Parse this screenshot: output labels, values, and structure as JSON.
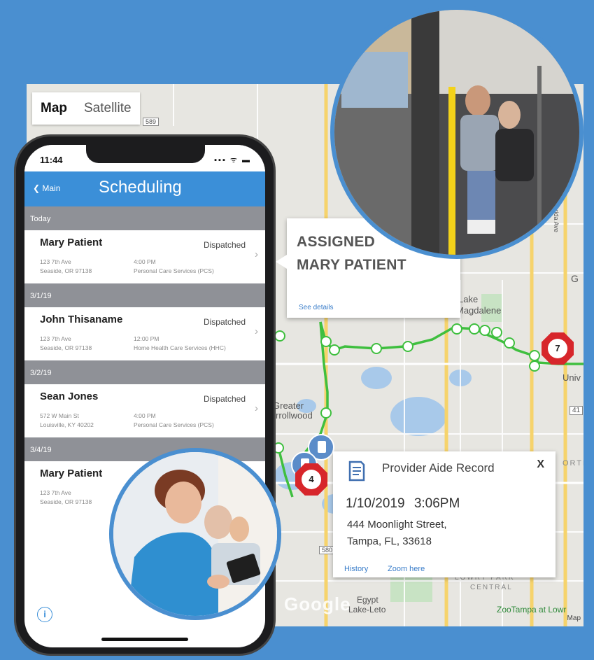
{
  "map": {
    "tabs": {
      "map": "Map",
      "satellite": "Satellite"
    },
    "labels": {
      "lake_magdalene_1": "Lake",
      "lake_magdalene_2": "Magdalene",
      "greater": "Greater",
      "carrollwood": "rrollwood",
      "n_florida_ave": "N Florida Ave",
      "lowry_park": "LOWRY PARK",
      "central": "CENTRAL",
      "egypt": "Egypt",
      "lake_leto": "Lake-Leto",
      "zootampa": "ZooTampa at Lowr",
      "g": "G",
      "univ": "Univ",
      "rte_41": "41",
      "rte_589": "589",
      "rte_580": "580",
      "orte": "ORTE"
    },
    "google": "Google",
    "footer": "Map",
    "markers": {
      "seven": "7",
      "four": "4"
    }
  },
  "assigned_popup": {
    "line1": "ASSIGNED",
    "line2": "MARY PATIENT",
    "link": "See details"
  },
  "aide_popup": {
    "title": "Provider Aide Record",
    "close": "X",
    "date": "1/10/2019",
    "time": "3:06PM",
    "address_line1": "444 Moonlight Street,",
    "address_line2": "Tampa, FL, 33618",
    "history": "History",
    "zoom": "Zoom here"
  },
  "phone": {
    "time": "11:44",
    "signal": "▪▪▪ ᯤ ▬",
    "back": "❮ Main",
    "title": "Scheduling",
    "sections": [
      {
        "day": "Today",
        "name": "Mary Patient",
        "status": "Dispatched",
        "addr1": "123 7th Ave",
        "addr2": "Seaside, OR 97138",
        "time": "4:00 PM",
        "service": "Personal Care Services (PCS)"
      },
      {
        "day": "3/1/19",
        "name": "John Thisaname",
        "status": "Dispatched",
        "addr1": "123 7th Ave",
        "addr2": "Seaside, OR 97138",
        "time": "12:00 PM",
        "service": "Home Health Care Services (HHC)"
      },
      {
        "day": "3/2/19",
        "name": "Sean Jones",
        "status": "Dispatched",
        "addr1": "572 W Main St",
        "addr2": "Louisville, KY 40202",
        "time": "4:00 PM",
        "service": "Personal Care Services (PCS)"
      },
      {
        "day": "3/4/19",
        "name": "Mary Patient",
        "status": "",
        "addr1": "123 7th Ave",
        "addr2": "Seaside, OR 97138",
        "time": "",
        "service": ""
      }
    ],
    "info": "i"
  },
  "colors": {
    "background": "#4a8fd0",
    "nav": "#3b8fd8",
    "route": "#3fbf3f",
    "marker": "#d7262b"
  }
}
